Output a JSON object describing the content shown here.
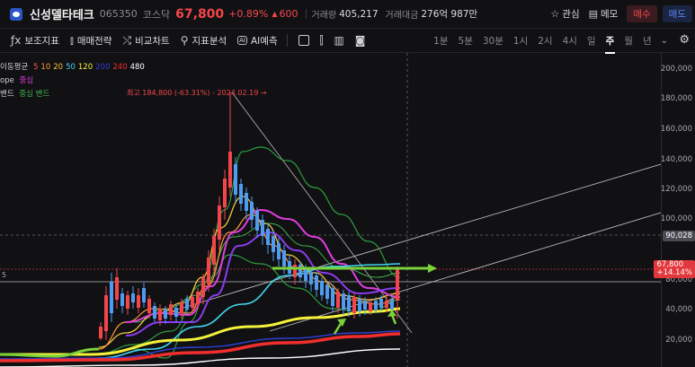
{
  "header": {
    "stock_name": "신성델타테크",
    "stock_code": "065350",
    "market": "코스닥",
    "price": "67,800",
    "change_pct": "+0.89%",
    "change_arrow": "▲",
    "change_abs": "600",
    "volume_label": "거래량",
    "volume_value": "405,217",
    "amount_label": "거래대금",
    "amount_value": "276억 987만",
    "watch_label": "관심",
    "memo_label": "메모",
    "buy_label": "매수",
    "sell_label": "매도"
  },
  "toolbar": {
    "tools": [
      "보조지표",
      "매매전략",
      "비교차트",
      "지표분석",
      "AI예측"
    ],
    "ai_box": "AI",
    "periods": [
      "1분",
      "5분",
      "30분",
      "1시",
      "2시",
      "4시",
      "일",
      "주",
      "월",
      "년"
    ],
    "active_period": "주"
  },
  "legend": {
    "ma_label": "이동평균",
    "ma_periods": [
      "5",
      "10",
      "20",
      "50",
      "120",
      "200",
      "240",
      "480"
    ],
    "ma_colors": [
      "#ff5252",
      "#ff9a3a",
      "#f3c83a",
      "#40d6f0",
      "#f5f23a",
      "#2f3fd0",
      "#f02e2e",
      "#ffffff"
    ],
    "envelope_label": "ope",
    "envelope_center": "중심",
    "bollinger_label": "밴드",
    "bollinger_center": "중심 밴드"
  },
  "annotations": {
    "high": "최고 184,800 (-63.31%) - 2024.02.19 →",
    "left_level": "5"
  },
  "y_axis": {
    "labels": [
      "200,000",
      "180,000",
      "160,000",
      "140,000",
      "120,000",
      "100,000",
      "80,000",
      "60,000",
      "40,000",
      "20,000"
    ],
    "level_tag": "90,028",
    "price_tag": "67,800",
    "price_tag_pct": "+14.14%"
  },
  "colors": {
    "up": "#f3464b",
    "down": "#4f9bf0",
    "accent_green": "#7cd23a",
    "bb_green": "#2f9c3f",
    "magenta": "#e03ce0",
    "purple": "#8a3cf0"
  }
}
